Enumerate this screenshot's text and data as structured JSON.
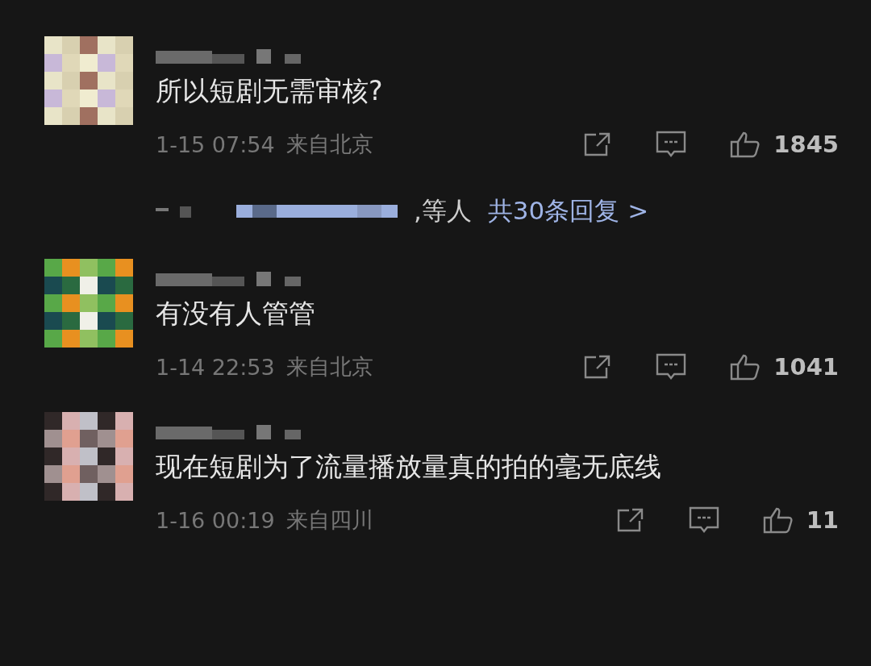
{
  "comments": [
    {
      "text": "所以短剧无需审核?",
      "time": "1-15 07:54",
      "location": "来自北京",
      "likes": "1845",
      "replies": {
        "suffix": ",等人",
        "link": "共30条回复 >"
      }
    },
    {
      "text": "有没有人管管",
      "time": "1-14 22:53",
      "location": "来自北京",
      "likes": "1041"
    },
    {
      "text": "现在短剧为了流量播放量真的拍的毫无底线",
      "time": "1-16 00:19",
      "location": "来自四川",
      "likes": "11"
    }
  ]
}
